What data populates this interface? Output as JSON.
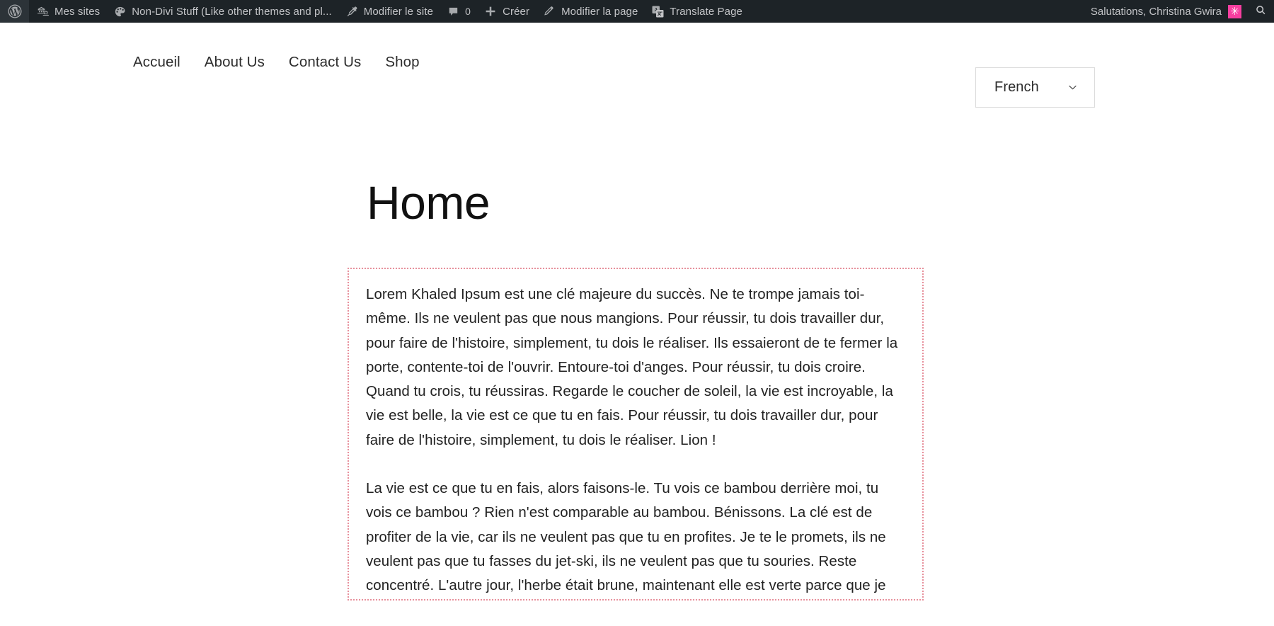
{
  "admin_bar": {
    "background_color": "#1d2327",
    "text_color": "#c3c4c7",
    "wp_logo_icon": "wordpress-logo-icon",
    "items": [
      {
        "label": "Mes sites",
        "icon": "my-sites-buildings-icon"
      },
      {
        "label": "Non-Divi Stuff (Like other themes and pl...",
        "icon": "divi-palette-icon"
      },
      {
        "label": "Modifier le site",
        "icon": "customize-paintbrush-icon"
      },
      {
        "label": "0",
        "icon": "comment-bubble-icon",
        "is_count": true
      },
      {
        "label": "Créer",
        "icon": "plus-icon"
      },
      {
        "label": "Modifier la page",
        "icon": "edit-pencil-icon"
      },
      {
        "label": "Translate Page",
        "icon": "translate-icon"
      }
    ],
    "greeting": "Salutations, Christina Gwira",
    "avatar_glyph": "✳",
    "avatar_color": "#f73fa0",
    "search_icon": "search-icon"
  },
  "site_header": {
    "nav": [
      {
        "label": "Accueil"
      },
      {
        "label": "About Us"
      },
      {
        "label": "Contact Us"
      },
      {
        "label": "Shop"
      }
    ],
    "language_selector": {
      "value": "French",
      "chevron_icon": "chevron-down-icon",
      "options": [
        "French"
      ]
    }
  },
  "main": {
    "page_title": "Home",
    "content_border_color": "#e7909c",
    "paragraphs": [
      "Lorem Khaled Ipsum est une clé majeure du succès. Ne te trompe jamais toi-même. Ils ne veulent pas que nous mangions. Pour réussir, tu dois travailler dur, pour faire de l'histoire, simplement, tu dois le réaliser. Ils essaieront de te fermer la porte, contente-toi de l'ouvrir. Entoure-toi d'anges. Pour réussir, tu dois croire. Quand tu crois, tu réussiras. Regarde le coucher de soleil, la vie est incroyable, la vie est belle, la vie est ce que tu en fais. Pour réussir, tu dois travailler dur, pour faire de l'histoire, simplement, tu dois le réaliser. Lion !",
      "La vie est ce que tu en fais, alors faisons-le. Tu vois ce bambou derrière moi, tu vois ce bambou ? Rien n'est comparable au bambou. Bénissons. La clé est de profiter de la vie, car ils ne veulent pas que tu en profites. Je te le promets, ils ne veulent pas que tu fasses du jet-ski, ils ne veulent pas que tu souries. Reste concentré. L'autre jour, l'herbe était brune, maintenant elle est verte parce que je"
    ]
  }
}
